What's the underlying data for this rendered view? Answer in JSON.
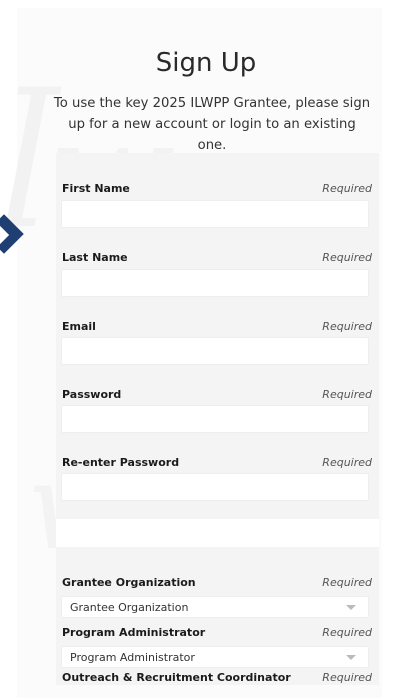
{
  "page": {
    "title": "Sign Up",
    "subtitle": "To use the key 2025 ILWPP Grantee, please sign up for a new account or login to an existing one."
  },
  "fields": [
    {
      "label": "First Name",
      "required": "Required",
      "value": ""
    },
    {
      "label": "Last Name",
      "required": "Required",
      "value": ""
    },
    {
      "label": "Email",
      "required": "Required",
      "value": ""
    },
    {
      "label": "Password",
      "required": "Required",
      "value": ""
    },
    {
      "label": "Re-enter Password",
      "required": "Required",
      "value": ""
    }
  ],
  "selects": [
    {
      "label": "Grantee Organization",
      "required": "Required",
      "selected": "Grantee Organization"
    },
    {
      "label": "Program Administrator",
      "required": "Required",
      "selected": "Program Administrator"
    }
  ],
  "partial_field": {
    "label": "Outreach & Recruitment Coordinator",
    "required": "Required"
  },
  "colors": {
    "accent": "#1f3f73",
    "form_bg": "#f4f4f4"
  },
  "icons": {
    "side_arrow": "chevron-right-icon",
    "select_caret": "caret-down-icon"
  }
}
